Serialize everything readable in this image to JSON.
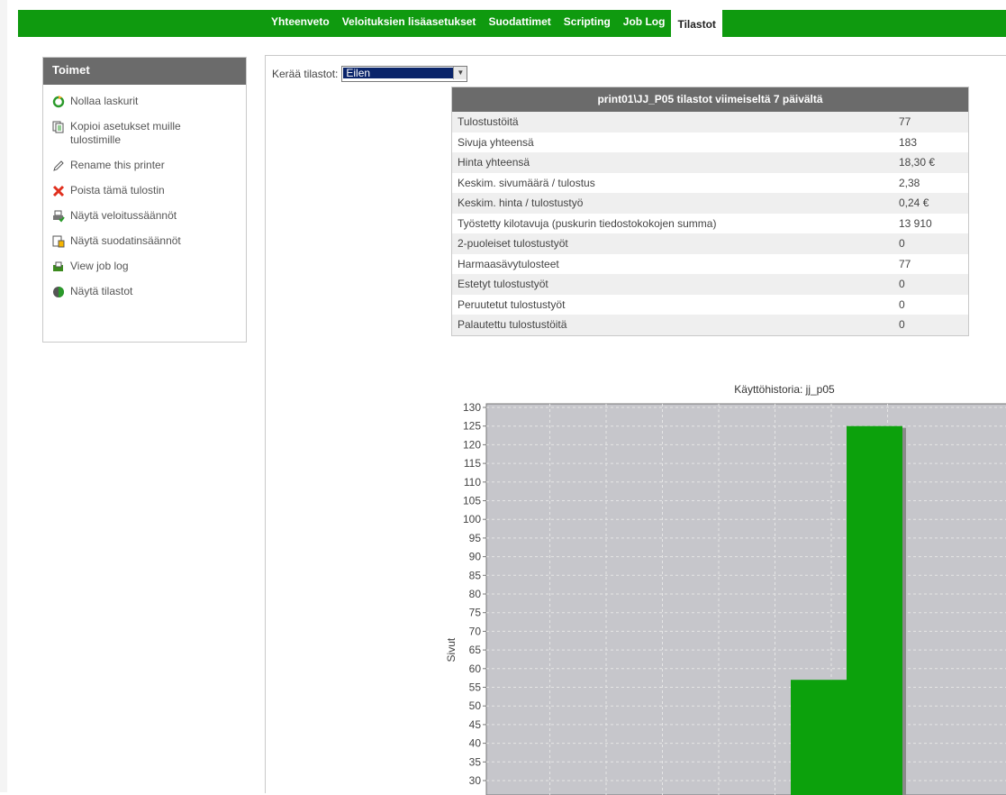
{
  "nav": {
    "tabs": [
      "Yhteenveto",
      "Veloituksien lisäasetukset",
      "Suodattimet",
      "Scripting",
      "Job Log",
      "Tilastot"
    ],
    "active": "Tilastot",
    "color": "#0f9a0f"
  },
  "sidebar": {
    "title": "Toimet",
    "items": [
      {
        "label": "Nollaa laskurit",
        "icon": "refresh-icon"
      },
      {
        "label": "Kopioi asetukset muille tulostimille",
        "icon": "copy-icon"
      },
      {
        "label": "Rename this printer",
        "icon": "pencil-icon"
      },
      {
        "label": "Poista tämä tulostin",
        "icon": "delete-icon"
      },
      {
        "label": "Näytä veloitussäännöt",
        "icon": "printer-rules-icon"
      },
      {
        "label": "Näytä suodatinsäännöt",
        "icon": "filter-rules-icon"
      },
      {
        "label": "View job log",
        "icon": "job-log-icon"
      },
      {
        "label": "Näytä tilastot",
        "icon": "pie-chart-icon"
      }
    ]
  },
  "collect": {
    "label": "Kerää tilastot:",
    "selected": "Eilen"
  },
  "stats": {
    "header": "print01\\JJ_P05 tilastot viimeiseltä 7 päivältä",
    "rows": [
      {
        "k": "Tulostustöitä",
        "v": "77"
      },
      {
        "k": "Sivuja yhteensä",
        "v": "183"
      },
      {
        "k": "Hinta yhteensä",
        "v": "18,30 €"
      },
      {
        "k": "Keskim. sivumäärä / tulostus",
        "v": "2,38"
      },
      {
        "k": "Keskim. hinta / tulostustyö",
        "v": "0,24 €"
      },
      {
        "k": "Työstetty kilotavuja (puskurin tiedostokokojen summa)",
        "v": "13 910"
      },
      {
        "k": "2-puoleiset tulostustyöt",
        "v": "0"
      },
      {
        "k": "Harmaasävytulosteet",
        "v": "77"
      },
      {
        "k": "Estetyt tulostustyöt",
        "v": "0"
      },
      {
        "k": "Peruutetut tulostustyöt",
        "v": "0"
      },
      {
        "k": "Palautettu tulostustöitä",
        "v": "0"
      }
    ]
  },
  "chart_data": {
    "type": "bar",
    "title": "Käyttöhistoria: jj_p05",
    "ylabel": "Sivut",
    "ylim_visible": [
      30,
      130
    ],
    "yticks": [
      30,
      35,
      40,
      45,
      50,
      55,
      60,
      65,
      70,
      75,
      80,
      85,
      90,
      95,
      100,
      105,
      110,
      115,
      120,
      125,
      130
    ],
    "values": [
      0,
      0,
      0,
      0,
      0,
      57,
      125
    ],
    "bar_color": "#0ca10c",
    "plot_bg": "#c6c6cb",
    "grid": true
  }
}
